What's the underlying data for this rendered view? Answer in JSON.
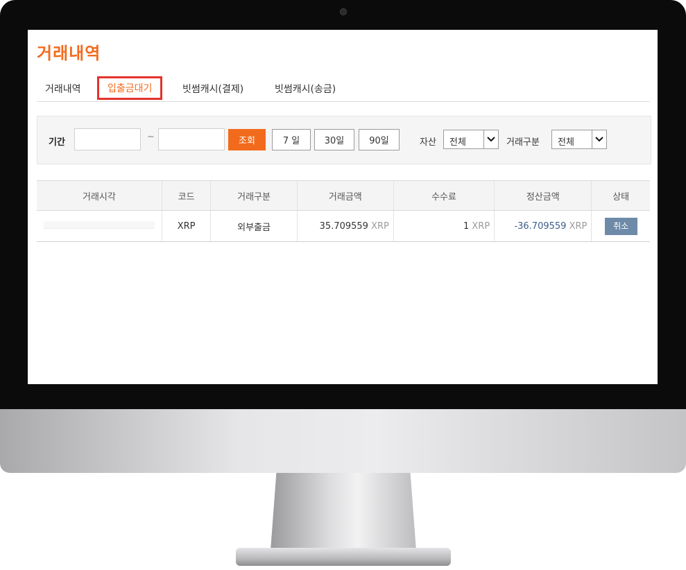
{
  "page_title": "거래내역",
  "tabs": [
    {
      "label": "거래내역"
    },
    {
      "label": "입출금대기"
    },
    {
      "label": "빗썸캐시(결제)"
    },
    {
      "label": "빗썸캐시(송금)"
    }
  ],
  "filter": {
    "period_label": "기간",
    "range_separator": "~",
    "start_date": "",
    "end_date": "",
    "search_button": "조회",
    "quick_ranges": [
      "7 일",
      "30일",
      "90일"
    ],
    "asset_label": "자산",
    "asset_value": "전체",
    "type_label": "거래구분",
    "type_value": "전체"
  },
  "table": {
    "columns": [
      "거래시각",
      "코드",
      "거래구분",
      "거래금액",
      "수수료",
      "정산금액",
      "상태"
    ],
    "rows": [
      {
        "time": "",
        "code": "XRP",
        "type": "외부출금",
        "amount": "35.709559",
        "amount_unit": "XRP",
        "fee": "1",
        "fee_unit": "XRP",
        "settlement": "-36.709559",
        "settlement_unit": "XRP",
        "status_button": "취소"
      }
    ]
  },
  "colors": {
    "accent": "#f26b1d",
    "highlight_border": "#e4322b",
    "cancel_button": "#6d8aa8"
  }
}
